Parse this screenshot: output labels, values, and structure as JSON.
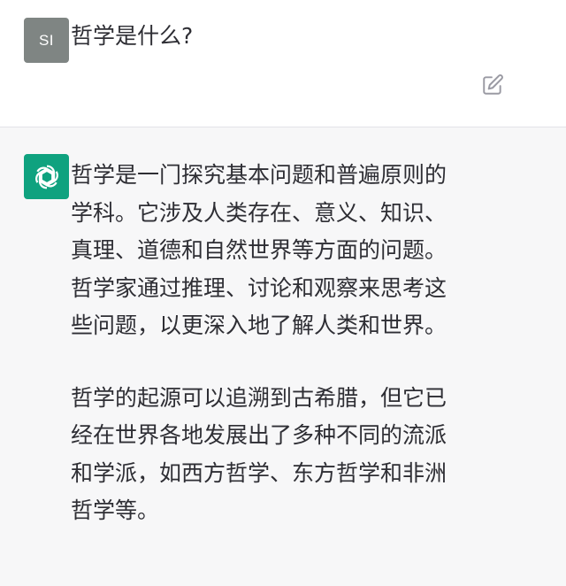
{
  "user": {
    "avatar_initials": "SI",
    "message": "哲学是什么?"
  },
  "assistant": {
    "avatar_icon": "openai-logo-icon",
    "paragraphs": [
      "哲学是一门探究基本问题和普遍原则的\n学科。它涉及人类存在、意义、知识、\n真理、道德和自然世界等方面的问题。\n哲学家通过推理、讨论和观察来思考这\n些问题，以更深入地了解人类和世界。",
      "哲学的起源可以追溯到古希腊，但它已\n经在世界各地发展出了多种不同的流派\n和学派，如西方哲学、东方哲学和非洲\n哲学等。"
    ]
  },
  "icons": {
    "edit": "edit-icon"
  },
  "colors": {
    "user_avatar_bg": "#7f8583",
    "assistant_avatar_bg": "#0fa27f",
    "assistant_panel_bg": "#f7f7f8",
    "text": "#2e2e34"
  }
}
